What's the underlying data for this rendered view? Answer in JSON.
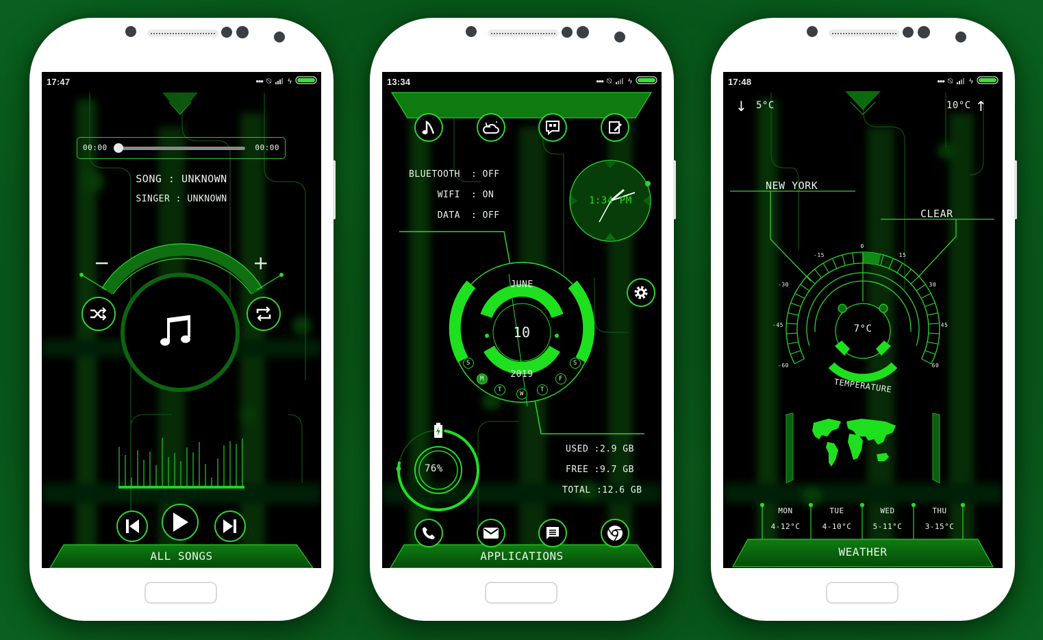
{
  "colors": {
    "accent": "#1fe01f",
    "accent_dim": "#0f6e12",
    "background": "#0b5c1c",
    "screen": "#000000",
    "phone_body": "#ffffff"
  },
  "phones": [
    {
      "name": "music",
      "status": {
        "time": "17:47",
        "icons": [
          "more-dots-icon",
          "vibrate-off-icon",
          "signal-icon",
          "charging-bolt-icon",
          "battery-icon"
        ]
      },
      "player": {
        "elapsed": "00:00",
        "duration": "00:00",
        "progress": 0,
        "song_label": "SONG : UNKNOWN",
        "singer_label": "SINGER : UNKNOWN",
        "volume_minus": "−",
        "volume_plus": "+",
        "shuffle_icon": "shuffle-icon",
        "repeat_icon": "repeat-icon",
        "album_icon": "music-note-icon",
        "visualizer_levels": [
          0.57,
          0.45,
          0.12,
          0.52,
          0.38,
          0.5,
          0.3,
          0.7,
          0.42,
          0.48,
          0.36,
          0.56,
          0.49,
          0.64,
          0.32,
          0.12,
          0.4,
          0.59,
          0.65,
          0.61,
          0.69
        ],
        "prev_icon": "skip-previous-icon",
        "play_icon": "play-icon",
        "next_icon": "skip-next-icon"
      },
      "dock_label": "ALL SONGS"
    },
    {
      "name": "launcher",
      "status": {
        "time": "13:34",
        "icons": [
          "more-dots-icon",
          "vibrate-off-icon",
          "signal-icon",
          "charging-bolt-icon",
          "battery-icon"
        ]
      },
      "top_apps": [
        {
          "name": "music-app",
          "icon": "music-note-icon"
        },
        {
          "name": "weather-app",
          "icon": "cloud-moon-icon"
        },
        {
          "name": "hangouts-app",
          "icon": "quote-chat-icon"
        },
        {
          "name": "notes-app",
          "icon": "notepad-edit-icon"
        }
      ],
      "toggles": [
        {
          "label": "BLUETOOTH",
          "value": ": OFF"
        },
        {
          "label": "WIFI",
          "value": ": ON"
        },
        {
          "label": "DATA",
          "value": ": OFF"
        }
      ],
      "clock": {
        "digital": "1:34 PM"
      },
      "calendar": {
        "month": "JUNE",
        "day": "10",
        "year": "2019",
        "weekdays": [
          "S",
          "M",
          "T",
          "W",
          "T",
          "F",
          "S"
        ],
        "active_weekday": 1
      },
      "settings_icon": "gear-icon",
      "battery": {
        "percent_label": "76%",
        "level": 0.76,
        "icon": "battery-charging-icon"
      },
      "storage": {
        "used": "USED :2.9 GB",
        "free": "FREE :9.7 GB",
        "total": "TOTAL :12.6 GB"
      },
      "dock_apps": [
        {
          "name": "phone-app",
          "icon": "phone-icon"
        },
        {
          "name": "email-app",
          "icon": "mail-icon"
        },
        {
          "name": "messages-app",
          "icon": "message-icon"
        },
        {
          "name": "chrome-app",
          "icon": "chrome-icon"
        }
      ],
      "dock_label": "APPLICATIONS"
    },
    {
      "name": "weather",
      "status": {
        "time": "17:48",
        "icons": [
          "more-dots-icon",
          "vibrate-off-icon",
          "signal-icon",
          "charging-bolt-icon",
          "battery-icon"
        ]
      },
      "low": "5°C",
      "high": "10°C",
      "city": "NEW YORK",
      "condition": "CLEAR",
      "gauge": {
        "ticks": [
          "-60",
          "-45",
          "-30",
          "-15",
          "0",
          "15",
          "30",
          "45",
          "60"
        ],
        "current": "7°C",
        "current_value": 7,
        "caption": "TEMPERATURE"
      },
      "forecast": [
        {
          "day": "MON",
          "range": "4-12°C"
        },
        {
          "day": "TUE",
          "range": "4-10°C"
        },
        {
          "day": "WED",
          "range": "5-11°C"
        },
        {
          "day": "THU",
          "range": "3-15°C"
        }
      ],
      "dock_label": "WEATHER"
    }
  ]
}
